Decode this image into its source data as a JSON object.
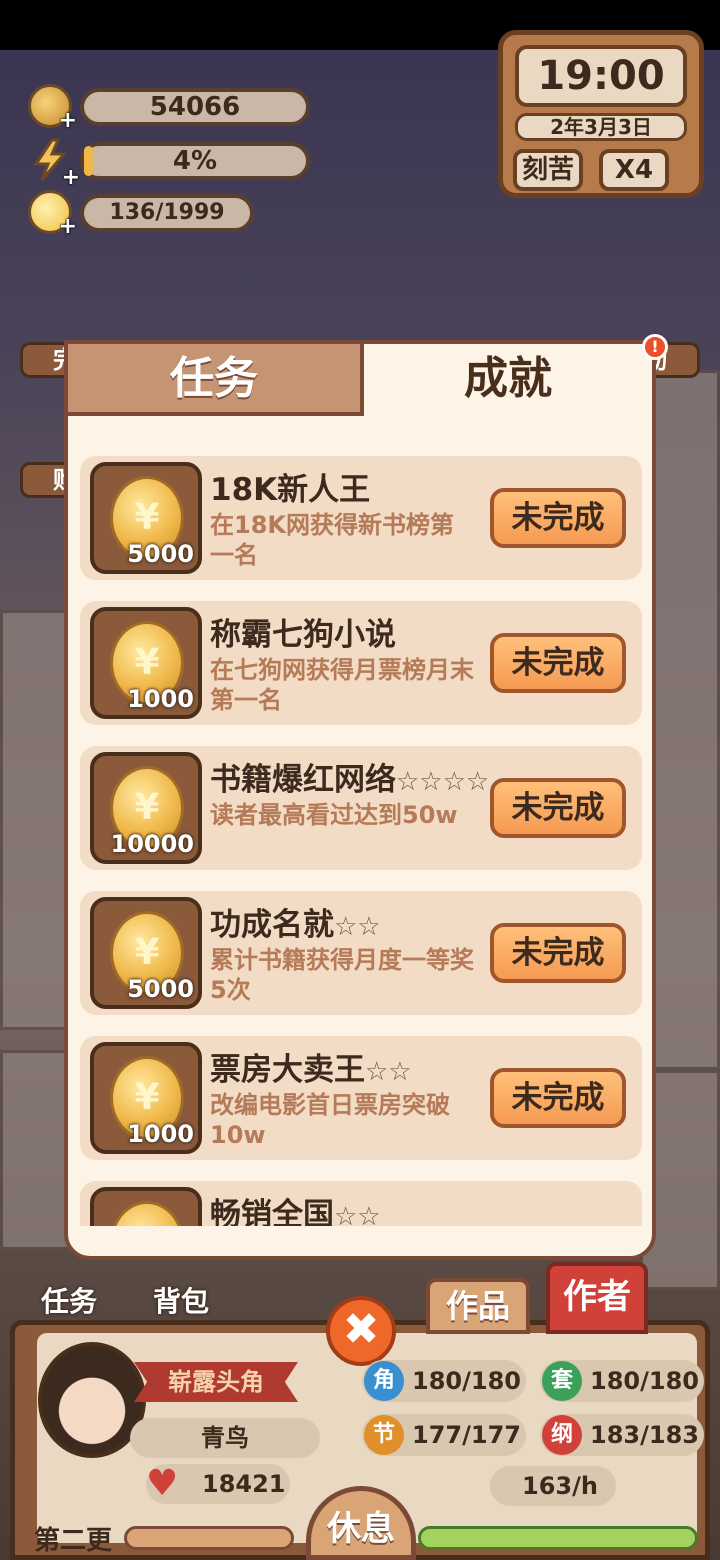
{
  "resources": {
    "coins": "54066",
    "energy": "4%",
    "energy_fraction": 0.04,
    "inspiration": "136/1999",
    "inspiration_fraction": 0.068
  },
  "clock": {
    "time": "19:00",
    "date": "2年3月3日",
    "mode": "刻苦",
    "speed": "X4"
  },
  "side_buttons": {
    "left_top": "完",
    "left_mid": "购",
    "right_top": "动"
  },
  "panel": {
    "tabs": [
      {
        "label": "任务",
        "active": false
      },
      {
        "label": "成就",
        "active": true
      }
    ],
    "alert": "!"
  },
  "achievements": [
    {
      "title": "18K新人王",
      "stars": "",
      "desc": "在18K网获得新书榜第一名",
      "reward": "5000",
      "status": "未完成"
    },
    {
      "title": "称霸七狗小说",
      "stars": "",
      "desc": "在七狗网获得月票榜月末第一名",
      "reward": "1000",
      "status": "未完成"
    },
    {
      "title": "书籍爆红网络",
      "stars": "☆☆☆☆",
      "desc": "读者最高看过达到50w",
      "reward": "10000",
      "status": "未完成"
    },
    {
      "title": "功成名就",
      "stars": "☆☆",
      "desc": "累计书籍获得月度一等奖5次",
      "reward": "5000",
      "status": "未完成"
    },
    {
      "title": "票房大卖王",
      "stars": "☆☆",
      "desc": "改编电影首日票房突破10w",
      "reward": "1000",
      "status": "未完成"
    },
    {
      "title": "畅销全国",
      "stars": "☆☆",
      "desc": "",
      "reward": "",
      "status": ""
    }
  ],
  "bottom_nav": {
    "tasks": "任务",
    "bag": "背包",
    "works": "作品",
    "author": "作者",
    "close": "✖"
  },
  "profile": {
    "rank": "崭露头角",
    "name": "青鸟",
    "fans": "18421",
    "stats": [
      {
        "icon": "角",
        "value": "180/180",
        "color": "#3a8fd0"
      },
      {
        "icon": "套",
        "value": "180/180",
        "color": "#3aa05a"
      },
      {
        "icon": "节",
        "value": "177/177",
        "color": "#e0902a"
      },
      {
        "icon": "纲",
        "value": "183/183",
        "color": "#d0413a"
      }
    ],
    "rate": "163/h",
    "chapter": "第二更",
    "rest": "休息"
  }
}
